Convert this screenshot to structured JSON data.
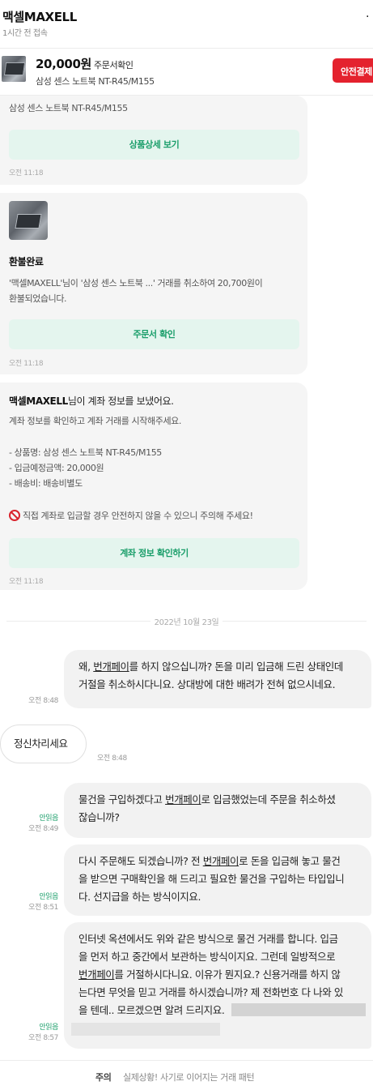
{
  "header": {
    "name": "맥셀MAXELL",
    "status": "1시간 전 접속",
    "more": "."
  },
  "product": {
    "price": "20,000원",
    "order_link": "주문서확인",
    "title": "삼성 센스 노트북 NT-R45/M155",
    "safe_pay": "안전결제"
  },
  "card1": {
    "text": "삼성 센스 노트북 NT-R45/M155",
    "button": "상품상세 보기",
    "time": "오전 11:18"
  },
  "card2": {
    "title": "환불완료",
    "text1": "'맥셀MAXELL'님이 '삼성 센스 노트북 ...' 거래를 취소하여 20,700원이",
    "text2": "환불되었습니다.",
    "button": "주문서 확인",
    "time": "오전 11:18"
  },
  "card3": {
    "title_name": "맥셀MAXELL",
    "title_rest": "님이 계좌 정보를 보냈어요.",
    "text1": "계좌 정보를 확인하고 계좌 거래를 시작해주세요.",
    "item": "- 상품명: 삼성 센스 노트북 NT-R45/M155",
    "amount": "- 입금예정금액: 20,000원",
    "shipping": "- 배송비: 배송비별도",
    "warning": "직접 계좌로 입금할 경우 안전하지 않을 수 있으니 주의해 주세요!",
    "button": "계좌 정보 확인하기",
    "time": "오전 11:18"
  },
  "date_separator": "2022년 10월 23일",
  "messages": {
    "m1": {
      "l1a": "왜, ",
      "l1u": "번개페이",
      "l1b": "를 하지 않으십니까? 돈을 미리 입금해 드린 상태인데",
      "l2": "거절을 취소하시다니요. 상대방에 대한 배려가 전혀 없으시네요.",
      "time": "오전 8:48"
    },
    "m2": {
      "text": "정신차리세요",
      "time": "오전 8:48"
    },
    "m3": {
      "l1a": "물건을 구입하겠다고 ",
      "l1u": "번개페이",
      "l1b": "로 입금했었는데 주문을 취소하셨",
      "l2": "잖습니까?",
      "read": "안읽음",
      "time": "오전 8:49"
    },
    "m4": {
      "l1a": "다시 주문해도 되겠습니까? 전 ",
      "l1u": "번개페이",
      "l1b": "로 돈을 입금해 놓고 물건",
      "l2": "을 받으면 구매확인을 해 드리고 필요한 물건을 구입하는 타입입니",
      "l3": "다. 선지급을 하는 방식이지요.",
      "read": "안읽음",
      "time": "오전 8:51"
    },
    "m5": {
      "l1": "인터넷 옥션에서도 위와 같은 방식으로 물건 거래를 합니다. 입금",
      "l2": "을 먼저 하고 중간에서 보관하는 방식이지요. 그런데 일방적으로",
      "l3u": "번개페이",
      "l3b": "를 거절하시다니요. 이유가 뭔지요.? 신용거래를 하지 않",
      "l4": "는다면 무엇을 믿고 거래를 하시겠습니까? 제 전화번호 다 나와 있",
      "l5": "을 텐데.. 모르겠으면 알려 드리지요.",
      "read": "안읽음",
      "time": "오전 8:57"
    }
  },
  "footer": {
    "label": "주의",
    "message": "실제상황! 사기로 이어지는 거래 패턴"
  }
}
